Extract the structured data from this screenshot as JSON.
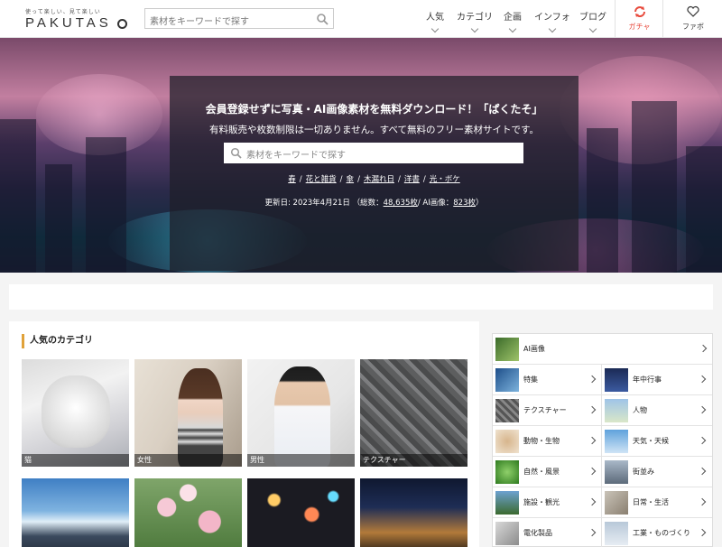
{
  "header": {
    "logo_tagline": "使って楽しい、見て楽しい",
    "logo_text": "PAKUTAS",
    "search_placeholder": "素材をキーワードで探す",
    "nav": [
      "人気",
      "カテゴリ",
      "企画",
      "インフォ",
      "ブログ"
    ],
    "gacha_label": "ガチャ",
    "fav_label": "ファボ"
  },
  "hero": {
    "title": "会員登録せずに写真・AI画像素材を無料ダウンロード！「ぱくたそ」",
    "subtitle": "有料販売や枚数制限は一切ありません。すべて無料のフリー素材サイトです。",
    "search_placeholder": "素材をキーワードで探す",
    "tags": [
      "春",
      "花と雑貨",
      "傘",
      "木漏れ日",
      "洋書",
      "光・ボケ"
    ],
    "update_prefix": "更新日: 2023年4月21日 （総数：",
    "total_count": "48,635枚",
    "ai_prefix": "/ AI画像：",
    "ai_count": "823枚",
    "update_suffix": "）"
  },
  "popular": {
    "title": "人気のカテゴリ",
    "tiles": [
      "猫",
      "女性",
      "男性",
      "テクスチャー"
    ]
  },
  "sidebar": {
    "full_row": "AI画像",
    "left": [
      "特集",
      "テクスチャー",
      "動物・生物",
      "自然・風景",
      "施設・観光",
      "電化製品"
    ],
    "right": [
      "年中行事",
      "人物",
      "天気・天候",
      "街並み",
      "日常・生活",
      "工業・ものづくり"
    ]
  },
  "colors": {
    "accent": "#e84a3c",
    "heading_bar": "#e0a23a"
  }
}
